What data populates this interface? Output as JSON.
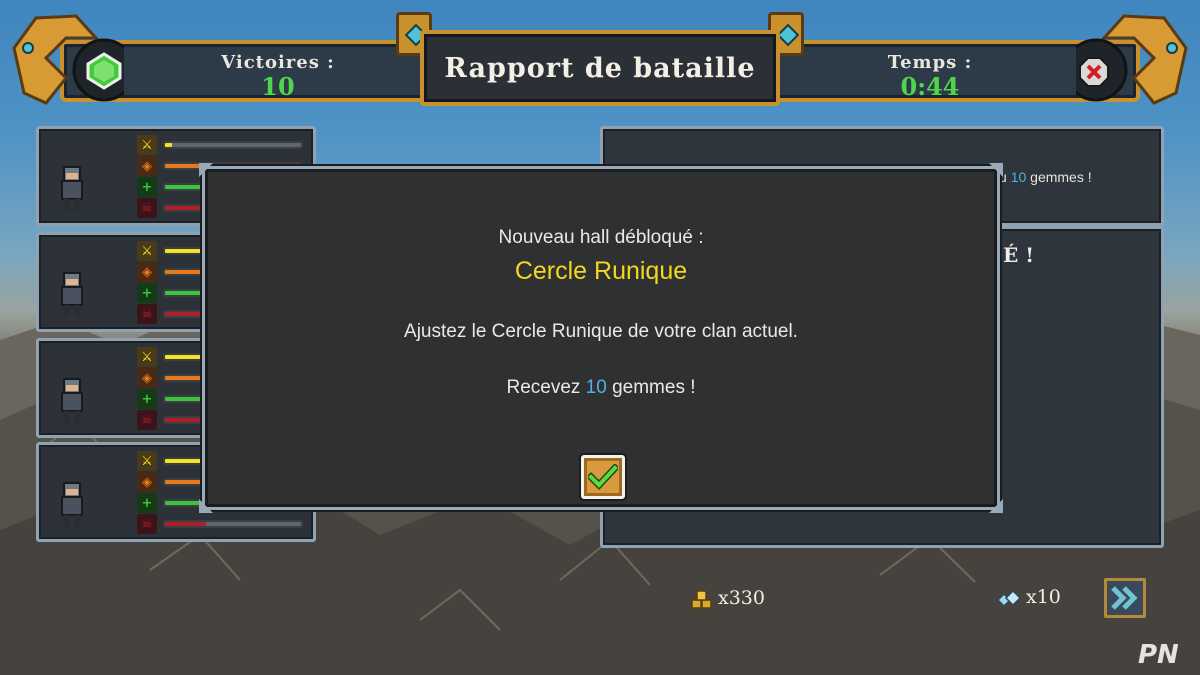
{
  "header": {
    "victories_label": "Victoires :",
    "victories_value": "10",
    "title": "Rapport de bataille",
    "time_label": "Temps :",
    "time_value": "0:44"
  },
  "units": [
    {
      "bars": [
        0.05,
        0.3,
        0.3,
        0.3
      ]
    },
    {
      "bars": [
        0.85,
        0.6,
        0.3,
        0.7
      ]
    },
    {
      "bars": [
        0.95,
        0.3,
        0.3,
        0.3
      ]
    },
    {
      "bars": [
        0.3,
        0.3,
        0.9,
        0.3
      ]
    }
  ],
  "bar_colors": [
    "#f2e41e",
    "#e8781e",
    "#3cc43c",
    "#b01e2a"
  ],
  "right_panel": {
    "partial_reward_prefix": "u",
    "partial_reward_number": "10",
    "partial_reward_suffix": "gemmes !",
    "partial_heading": "É !"
  },
  "modal": {
    "heading": "Nouveau hall débloqué :",
    "hall_name": "Cercle Runique",
    "description": "Ajustez le Cercle Runique de votre clan actuel.",
    "reward_prefix": "Recevez",
    "reward_number": "10",
    "reward_suffix": "gemmes !"
  },
  "rewards": {
    "gold": "x330",
    "gems": "x10"
  },
  "watermark": "PN",
  "icons": {
    "victory": "green-gem-icon",
    "close": "red-x-icon",
    "confirm": "checkmark-icon",
    "next": "double-chevron-right-icon",
    "gold": "gold-coins-icon",
    "gems": "gem-pile-icon"
  }
}
